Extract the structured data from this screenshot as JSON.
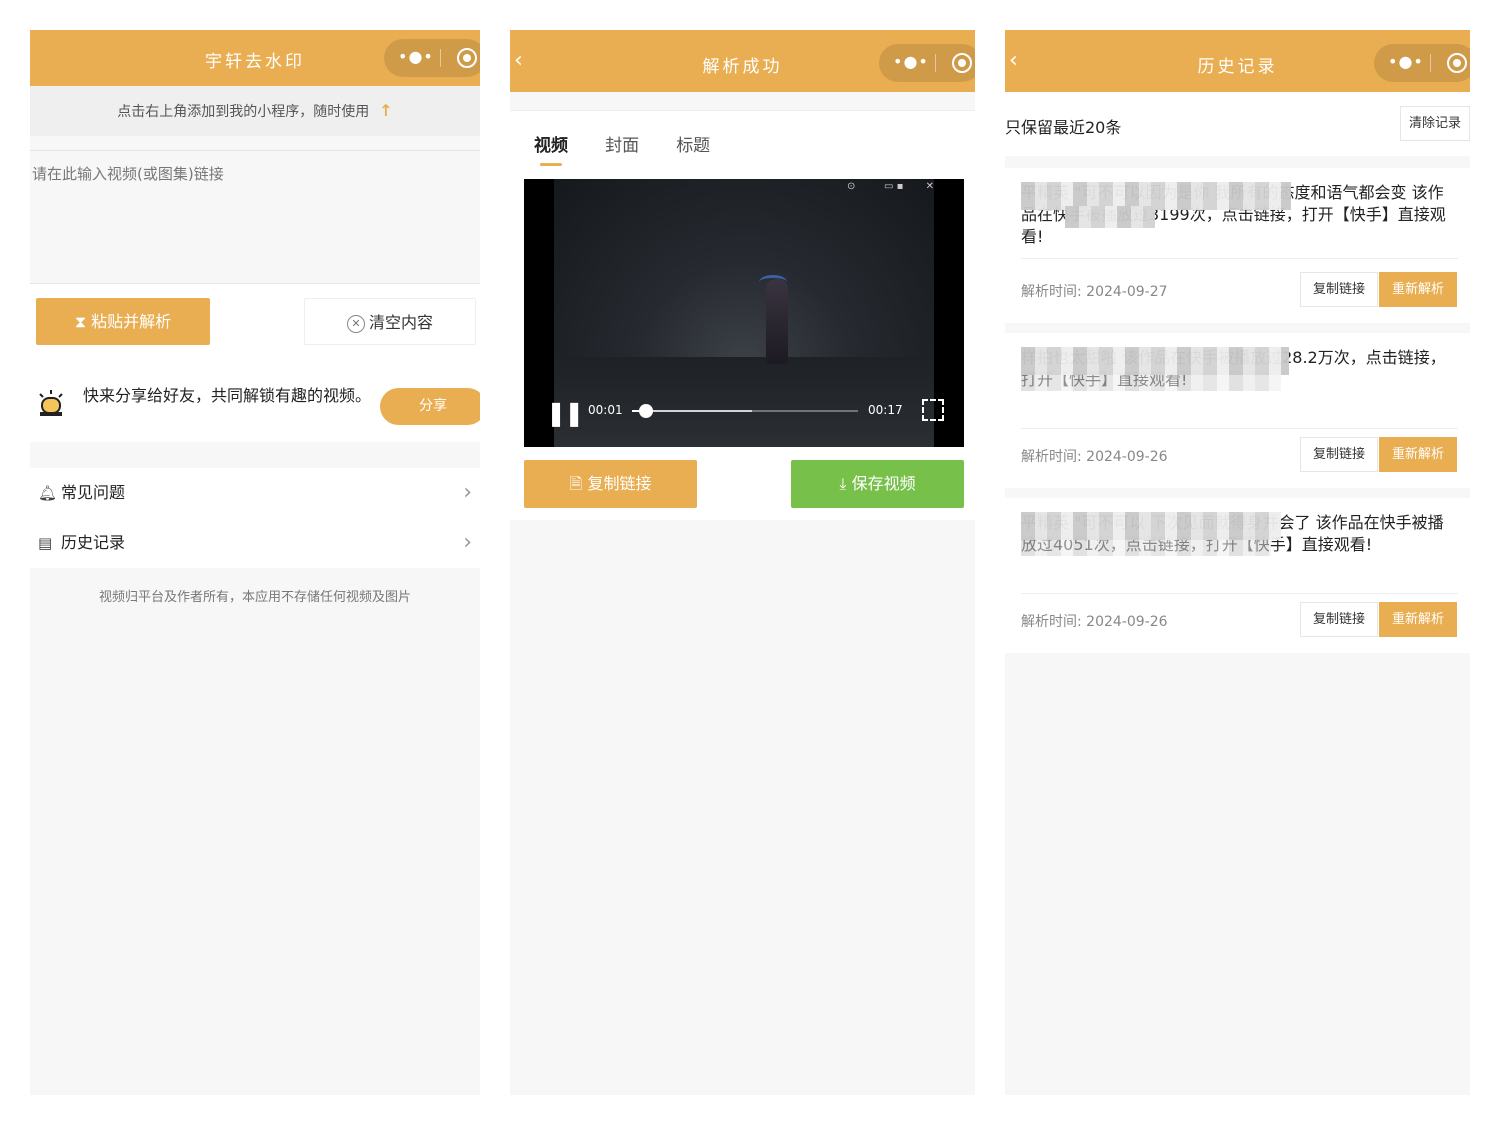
{
  "panel1": {
    "title": "宇轩去水印",
    "capsule": {
      "more_icon": "more-dots-icon",
      "close_icon": "target-close-icon"
    },
    "tip": "点击右上角添加到我的小程序，随时使用",
    "input_placeholder": "请在此输入视频(或图集)链接",
    "paste_button": "粘贴并解析",
    "clear_button": "清空内容",
    "share_text": "快来分享给好友，共同解锁有趣的视频。",
    "share_button": "分享",
    "menu": [
      {
        "label": "常见问题",
        "icon": "bell-icon"
      },
      {
        "label": "历史记录",
        "icon": "list-icon"
      }
    ],
    "footer_note": "视频归平台及作者所有，本应用不存储任何视频及图片"
  },
  "panel2": {
    "title": "解析成功",
    "tabs": [
      "视频",
      "封面",
      "标题"
    ],
    "active_tab": 0,
    "video": {
      "current_time": "00:01",
      "duration": "00:17",
      "played_fraction": 0.06,
      "buffered_fraction": 0.53
    },
    "copy_button": "复制链接",
    "save_button": "保存视频"
  },
  "panel3": {
    "title": "历史记录",
    "note": "只保留最近20条",
    "clear_button": "清除记录",
    "time_label": "解析时间:",
    "copy_button": "复制链接",
    "reparse_button": "重新解析",
    "items": [
      {
        "text_visible": "平精英 \"可不可以因为是你 我所有的态度和语气都会变 该作品在快手被播放过3199次，点击链接，打开【快手】直接观看!",
        "date": "2024-09-27"
      },
      {
        "text_visible": "样拍也太甜啦 该作品在快手被播放过28.2万次，点击链接，打开【快手】直接观看!",
        "date": "2024-09-26"
      },
      {
        "text_visible": "平精英 \"可不可以 下次见面就得身并会了 该作品在快手被播放过4051次，点击链接，打开【快手】直接观看!",
        "date": "2024-09-26"
      }
    ]
  },
  "colors": {
    "accent": "#e9ae51",
    "green": "#77c14b",
    "background": "#f7f7f7"
  }
}
